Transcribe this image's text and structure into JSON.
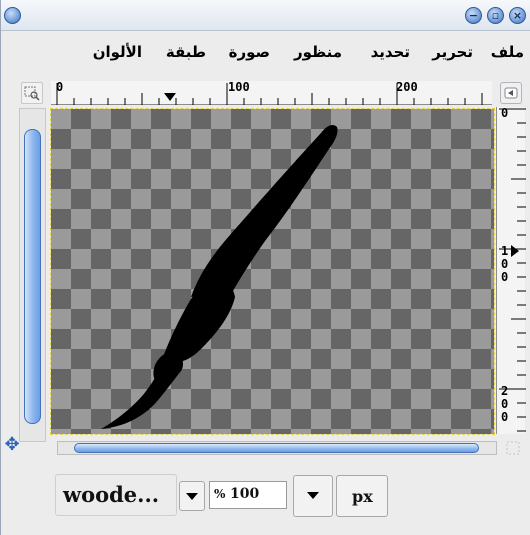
{
  "window": {
    "icon": "window-menu-icon",
    "controls": [
      "minimize-icon",
      "maximize-icon",
      "close-icon"
    ],
    "accent_color": "#4f82c9"
  },
  "menubar": {
    "items": [
      "ملف",
      "تحرير",
      "تحديد",
      "منظور",
      "صورة",
      "طبقة",
      "الألوان"
    ]
  },
  "top_ruler": {
    "labels": [
      "0",
      "100",
      "200"
    ]
  },
  "right_ruler": {
    "labels": [
      "0",
      "1\n0\n0",
      "2\n0\n0"
    ]
  },
  "canvas": {
    "image": "paintbrush-silhouette",
    "background": "transparency-checkerboard"
  },
  "statusbar": {
    "layer_name": "woode...",
    "zoom_value": "100",
    "zoom_prefix": "%",
    "unit": "px"
  }
}
